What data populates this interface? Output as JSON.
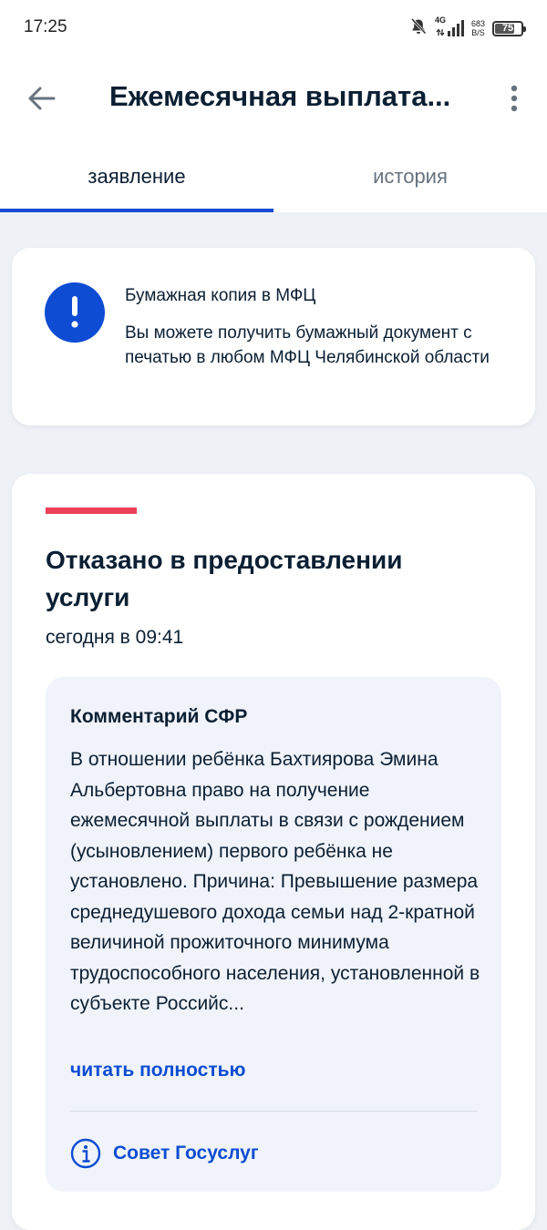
{
  "status_bar": {
    "time": "17:25",
    "network_type": "4G",
    "network_speed_value": "683",
    "network_speed_unit": "B/S",
    "battery_level": "75"
  },
  "app_bar": {
    "title": "Ежемесячная выплата..."
  },
  "tabs": [
    {
      "label": "заявление",
      "active": true
    },
    {
      "label": "история",
      "active": false
    }
  ],
  "notice": {
    "title": "Бумажная копия в МФЦ",
    "text": "Вы можете получить бумажный документ с печатью в любом МФЦ Челябинской области"
  },
  "status": {
    "title": "Отказано в предоставлении услуги",
    "time": "сегодня в 09:41",
    "stripe_color": "#ee3f58"
  },
  "comment": {
    "title": "Комментарий СФР",
    "text": "В отношении ребёнка Бахтиярова Эмина Альбертовна право на получение ежемесячной выплаты в связи с рождением (усыновлением) первого ребёнка не установлено. Причина: Превышение размера среднедушевого дохода семьи над 2-кратной величиной прожиточного минимума трудоспособного населения, установленной в субъекте Российс...",
    "read_more": "читать полностью",
    "advice": "Совет Госуслуг"
  },
  "colors": {
    "accent": "#0d4cd3",
    "text": "#0b1f33",
    "background": "#eef1f6"
  }
}
